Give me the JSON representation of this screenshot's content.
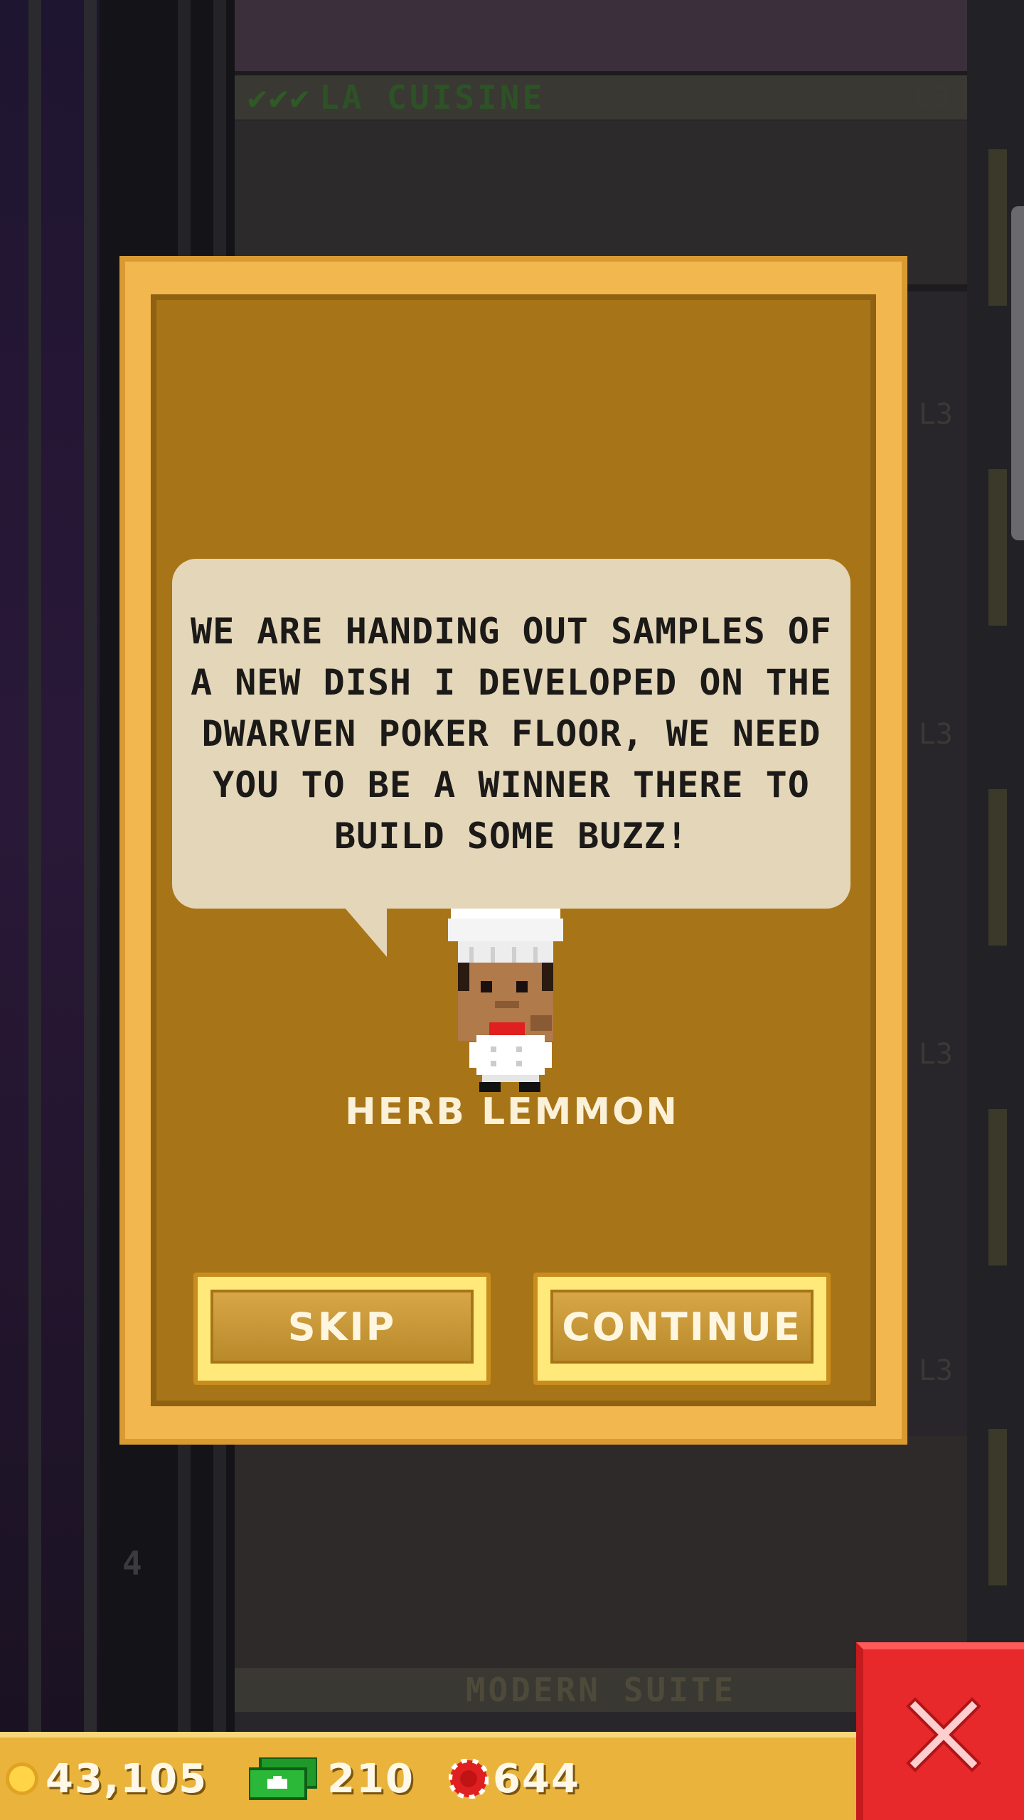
{
  "background": {
    "floors": [
      {
        "name": "LA CUISINE",
        "level": "L3",
        "checks": "✔✔✔"
      },
      {
        "name": "MODERN SUITE",
        "level": "",
        "checks": ""
      }
    ],
    "side_levels": [
      "L3",
      "L3",
      "L3",
      "L3"
    ],
    "floor_number": "4"
  },
  "dialog": {
    "message": "WE ARE HANDING OUT SAMPLES OF A NEW DISH I DEVELOPED ON THE DWARVEN POKER FLOOR, WE NEED YOU TO BE A WINNER THERE TO BUILD SOME BUZZ!",
    "npc_name": "HERB LEMMON",
    "skip_label": "SKIP",
    "continue_label": "CONTINUE"
  },
  "resources": {
    "coins": "43,105",
    "bux": "210",
    "chips": "644"
  },
  "icons": {
    "coin": "coin-icon",
    "bux": "bux-cash-icon",
    "chip": "poker-chip-icon",
    "close": "close-x-icon"
  },
  "colors": {
    "dialog_frame": "#f2b74e",
    "dialog_panel": "#a77518",
    "bubble": "#e4d6b8",
    "close_button": "#e8292c",
    "resource_bar": "#eab43c"
  }
}
